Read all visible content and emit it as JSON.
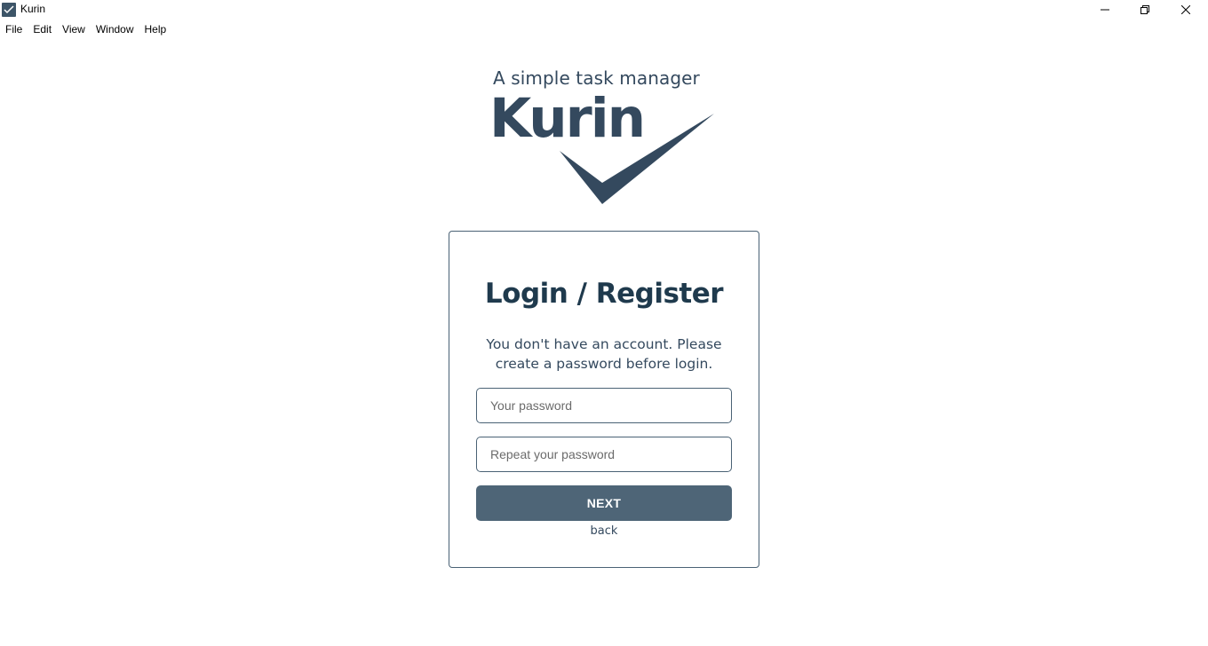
{
  "window": {
    "title": "Kurin",
    "icon": "kurin-app-icon",
    "controls": [
      "minimize-icon",
      "maximize-icon",
      "close-icon"
    ]
  },
  "menu": {
    "items": [
      "File",
      "Edit",
      "View",
      "Window",
      "Help"
    ]
  },
  "logo": {
    "tagline": "A simple task manager",
    "wordmark": "Kurin",
    "icon": "checkmark-icon",
    "color": "#34495e"
  },
  "card": {
    "title": "Login / Register",
    "message": "You don't have an account. Please create a password before login.",
    "password_placeholder": "Your password",
    "password_value": "",
    "repeat_placeholder": "Repeat your password",
    "repeat_value": "",
    "next_label": "NEXT",
    "back_label": "back"
  },
  "colors": {
    "primary": "#4e6577",
    "text": "#1f3a4d",
    "border": "#4a6275"
  }
}
